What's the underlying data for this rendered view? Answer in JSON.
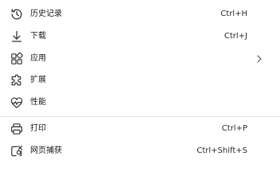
{
  "menu": {
    "items": [
      {
        "label": "历史记录",
        "shortcut": "Ctrl+H",
        "icon": "history-icon"
      },
      {
        "label": "下载",
        "shortcut": "Ctrl+J",
        "icon": "download-icon"
      },
      {
        "label": "应用",
        "shortcut": "",
        "icon": "apps-icon",
        "submenu": true
      },
      {
        "label": "扩展",
        "shortcut": "",
        "icon": "extensions-icon"
      },
      {
        "label": "性能",
        "shortcut": "",
        "icon": "performance-icon"
      },
      {
        "label": "打印",
        "shortcut": "Ctrl+P",
        "icon": "print-icon"
      },
      {
        "label": "网页捕获",
        "shortcut": "Ctrl+Shift+S",
        "icon": "web-capture-icon"
      }
    ]
  }
}
